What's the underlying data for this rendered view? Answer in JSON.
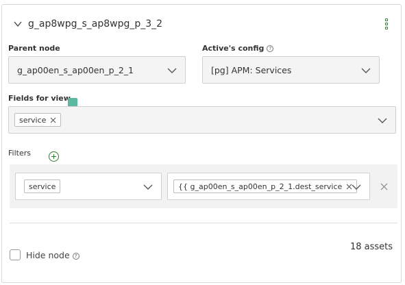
{
  "node": {
    "title": "g_ap8wpg_s_ap8wpg_p_3_2"
  },
  "parent_node": {
    "label": "Parent node",
    "value": "g_ap00en_s_ap00en_p_2_1"
  },
  "actives_config": {
    "label": "Active's config",
    "help": "?",
    "value": "[pg] APM: Services"
  },
  "fields_for_view": {
    "label": "Fields for view",
    "swatch_color": "#5cb89e",
    "tags": [
      "service"
    ]
  },
  "filters": {
    "label": "Filters",
    "rows": [
      {
        "field_tag": "service",
        "value_tag": "{{ g_ap00en_s_ap00en_p_2_1.dest_service"
      }
    ]
  },
  "footer": {
    "hide_node_label": "Hide node",
    "help": "?",
    "assets_text": "18 assets"
  },
  "colors": {
    "accent": "#2e7d32",
    "field_bg": "#f4f4f4"
  }
}
